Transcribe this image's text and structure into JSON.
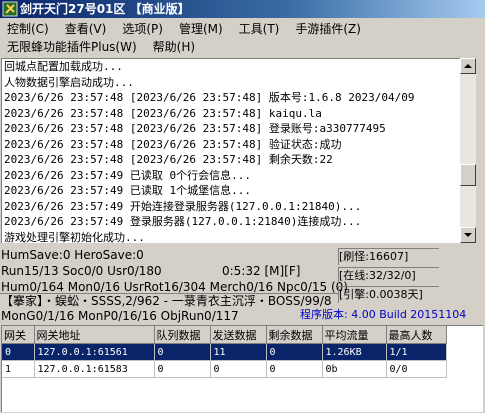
{
  "window": {
    "title": "剑开天门27号01区 【商业版】"
  },
  "menu": {
    "row1": [
      "控制(C)",
      "查看(V)",
      "选项(P)",
      "管理(M)",
      "工具(T)",
      "手游插件(Z)"
    ],
    "row2": [
      "无限蜂功能插件Plus(W)",
      "帮助(H)"
    ]
  },
  "log": {
    "lines": [
      "回城点配置加载成功...",
      "人物数据引擎启动成功...",
      "2023/6/26 23:57:48 [2023/6/26 23:57:48] 版本号:1.6.8 2023/04/09",
      "2023/6/26 23:57:48 [2023/6/26 23:57:48] kaiqu.la",
      "2023/6/26 23:57:48 [2023/6/26 23:57:48] 登录账号:a330777495",
      "2023/6/26 23:57:48 [2023/6/26 23:57:48] 验证状态:成功",
      "2023/6/26 23:57:48 [2023/6/26 23:57:48] 剩余天数:22",
      "2023/6/26 23:57:49 已读取 0个行会信息...",
      "2023/6/26 23:57:49 已读取 1个城堡信息...",
      "2023/6/26 23:57:49 开始连接登录服务器(127.0.0.1:21840)...",
      "2023/6/26 23:57:49 登录服务器(127.0.0.1:21840)连接成功...",
      "游戏处理引擎初始化成功..."
    ]
  },
  "status": {
    "hum_save": "HumSave:0 HeroSave:0",
    "run": "Run15/13 Soc0/0 Usr0/180",
    "clock": "0:5:32 [M][F]",
    "hum": "Hum0/164 Mon0/16 UsrRot16/304 Merch0/16 Npc0/15 (0)",
    "news": "【搴家】・蜈蚣・SSSS,2/962 - 一菉青衣主沉浮・BOSS/99/8",
    "mon": "MonG0/1/16 MonP0/16/16 ObjRun0/117"
  },
  "info": {
    "refresh": "[刷怪:16607]",
    "online": "[在线:32/32/0]",
    "engine": "[引擎:0.0038天]"
  },
  "version": "程序版本: 4.00 Build 20151104",
  "gateway_table": {
    "columns": [
      "网关",
      "网关地址",
      "队列数据",
      "发送数据",
      "剩余数据",
      "平均流量",
      "最高人数"
    ],
    "rows": [
      [
        "0",
        "127.0.0.1:61561",
        "0",
        "11",
        "0",
        "1.26KB",
        "1/1"
      ],
      [
        "1",
        "127.0.0.1:61583",
        "0",
        "0",
        "0",
        "0b",
        "0/0"
      ]
    ],
    "selected_row": 0
  },
  "colors": {
    "selection": "#0a246a",
    "version_text": "#0000c8"
  }
}
